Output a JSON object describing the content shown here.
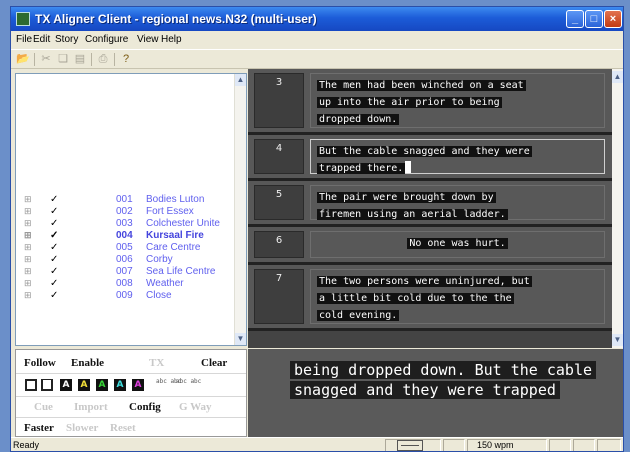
{
  "window": {
    "title": "TX Aligner Client - regional news.N32 (multi-user)"
  },
  "window_controls": {
    "minimize": "_",
    "maximize": "□",
    "close": "×"
  },
  "menu": [
    "File",
    "Edit",
    "Story",
    "Configure",
    "View",
    "Help"
  ],
  "toolbar": {
    "icons": [
      "open-folder-icon",
      "cut-icon",
      "copy-icon",
      "paste-icon",
      "print-icon",
      "help-icon"
    ]
  },
  "stories": [
    {
      "expander": "⊞",
      "check": "✓",
      "num": "001",
      "name": "Bodies Luton",
      "active": false
    },
    {
      "expander": "⊞",
      "check": "✓",
      "num": "002",
      "name": "Fort Essex",
      "active": false
    },
    {
      "expander": "⊞",
      "check": "✓",
      "num": "003",
      "name": "Colchester Unite",
      "active": false
    },
    {
      "expander": "⊞",
      "check": "✓",
      "num": "004",
      "name": "Kursaal Fire",
      "active": true
    },
    {
      "expander": "⊞",
      "check": "✓",
      "num": "005",
      "name": "Care Centre",
      "active": false
    },
    {
      "expander": "⊞",
      "check": "✓",
      "num": "006",
      "name": "Corby",
      "active": false
    },
    {
      "expander": "⊞",
      "check": "✓",
      "num": "007",
      "name": "Sea Life Centre",
      "active": false
    },
    {
      "expander": "⊞",
      "check": "✓",
      "num": "008",
      "name": "Weather",
      "active": false
    },
    {
      "expander": "⊞",
      "check": "✓",
      "num": "009",
      "name": "Close",
      "active": false
    }
  ],
  "segments": [
    {
      "num": "3",
      "lines": [
        "The men had been winched on a seat",
        "up into the air prior to being",
        "dropped down."
      ]
    },
    {
      "num": "4",
      "lines": [
        "But the cable snagged and they were",
        "trapped there."
      ],
      "current": true
    },
    {
      "num": "5",
      "lines": [
        "The pair were brought down by",
        "firemen using an aerial ladder."
      ]
    },
    {
      "num": "6",
      "lines": [
        "No one was hurt."
      ],
      "centered": true
    },
    {
      "num": "7",
      "lines": [
        "The two persons were uninjured, but",
        "a little bit cold due to the the",
        "cold evening."
      ]
    }
  ],
  "controls": {
    "follow": "Follow",
    "enable": "Enable",
    "tx": "TX",
    "clear": "Clear",
    "cue": "Cue",
    "import": "Import",
    "config": "Config",
    "gway": "G Way",
    "faster": "Faster",
    "slower": "Slower",
    "reset": "Reset",
    "box_letters": [
      "A",
      "A",
      "A",
      "A",
      "A"
    ],
    "box_colors": [
      "#ffffff",
      "#f5e23a",
      "#37d637",
      "#3fe0e0",
      "#e040e0"
    ],
    "mini_labels": [
      "abc abc",
      "abc abc"
    ]
  },
  "caption": {
    "lines": [
      "being dropped down. But the cable",
      "snagged and they were trapped"
    ]
  },
  "status": {
    "text": "Ready",
    "wpm": "150 wpm"
  }
}
